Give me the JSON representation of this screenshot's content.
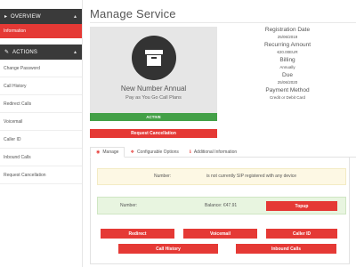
{
  "sidebar": {
    "overview": {
      "label": "OVERVIEW",
      "active_item": "Information"
    },
    "actions": {
      "label": "ACTIONS",
      "items": [
        "Change Password",
        "Call History",
        "Redirect Calls",
        "Voicemail",
        "Caller ID",
        "Inbound Calls",
        "Request Cancellation"
      ]
    }
  },
  "page": {
    "title": "Manage Service"
  },
  "product": {
    "name": "New Number Annual",
    "plan": "Pay as You Go Call Plans",
    "status": "ACTIVE",
    "icon": "archive-box-icon"
  },
  "request_cancellation_label": "Request Cancellation",
  "details": {
    "registration_date_label": "Registration Date",
    "registration_date": "25/06/2019",
    "recurring_amount_label": "Recurring Amount",
    "recurring_amount": "€20.00EUR",
    "billing_label": "Billing",
    "billing": "Annually",
    "due_label": "Due",
    "due": "25/06/2020",
    "payment_method_label": "Payment Method",
    "payment_method": "Credit or Debit Card"
  },
  "tabs": [
    {
      "label": "Manage",
      "icon": "target-icon"
    },
    {
      "label": "Configurable Options",
      "icon": "cubes-icon"
    },
    {
      "label": "Additional Information",
      "icon": "info-icon"
    }
  ],
  "manage": {
    "number_label": "Number:",
    "number_message": "is not currently SIP registered with any device",
    "balance_number_label": "Number:",
    "balance": "Balance: €47.91",
    "topup_label": "Topup",
    "actions": [
      "Redirect",
      "Voicemail",
      "Caller ID",
      "Call History",
      "Inbound Calls"
    ]
  },
  "colors": {
    "accent_red": "#e53935",
    "active_green": "#43a047",
    "sidebar_dark": "#3a3a3a"
  }
}
